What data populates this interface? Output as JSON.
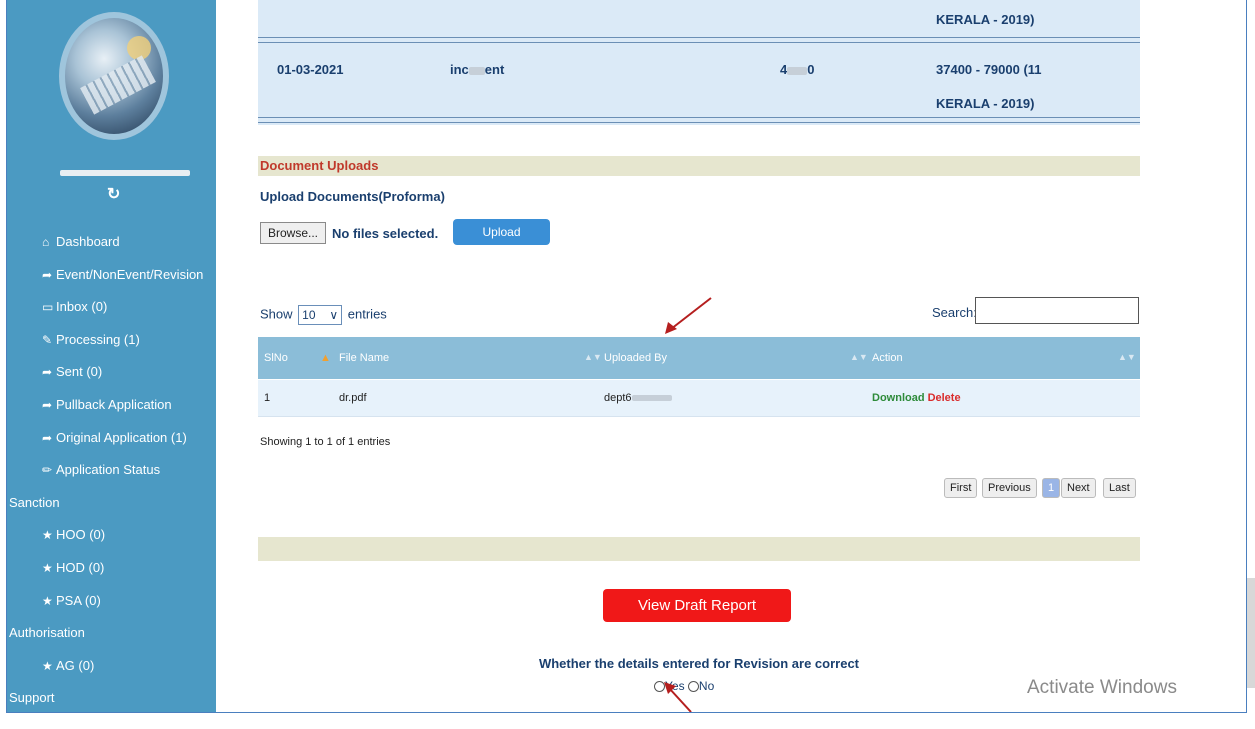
{
  "sidebar": {
    "refresh_icon": "refresh-icon",
    "items": [
      {
        "icon": "home-icon",
        "glyph": "⌂",
        "label": "Dashboard"
      },
      {
        "icon": "share-icon",
        "glyph": "➦",
        "label": "Event/NonEvent/Revision"
      },
      {
        "icon": "inbox-icon",
        "glyph": "▭",
        "label": "Inbox (0)"
      },
      {
        "icon": "edit-icon",
        "glyph": "✎",
        "label": "Processing (1)"
      },
      {
        "icon": "share-icon",
        "glyph": "➦",
        "label": "Sent (0)"
      },
      {
        "icon": "share-icon",
        "glyph": "➦",
        "label": "Pullback Application"
      },
      {
        "icon": "share-icon",
        "glyph": "➦",
        "label": "Original Application (1)"
      },
      {
        "icon": "pencil-icon",
        "glyph": "✏",
        "label": "Application Status"
      }
    ],
    "sanction_label": "Sanction",
    "sanction_items": [
      {
        "icon": "star-icon",
        "glyph": "★",
        "label": "HOO (0)"
      },
      {
        "icon": "star-icon",
        "glyph": "★",
        "label": "HOD (0)"
      },
      {
        "icon": "star-icon",
        "glyph": "★",
        "label": "PSA (0)"
      }
    ],
    "authorisation_label": "Authorisation",
    "authorisation_items": [
      {
        "icon": "star-icon",
        "glyph": "★",
        "label": "AG (0)"
      }
    ],
    "support_label": "Support"
  },
  "revision_table": {
    "row0": {
      "scale": "KERALA - 2019)"
    },
    "row1": {
      "date": "01-03-2021",
      "type_prefix": "inc",
      "type_suffix": "ent",
      "amount_prefix": "4",
      "amount_suffix": "0",
      "scale_line1": "37400 - 79000 (11",
      "scale_line2": "KERALA - 2019)"
    }
  },
  "uploads": {
    "section_title": "Document Uploads",
    "subtitle": "Upload Documents(Proforma)",
    "browse_label": "Browse...",
    "no_file_text": "No files selected.",
    "upload_label": "Upload"
  },
  "datatable": {
    "show_label": "Show",
    "page_length": "10",
    "entries_label": "entries",
    "search_label": "Search:",
    "search_value": "",
    "columns": [
      "SlNo",
      "File Name",
      "Uploaded By",
      "Action"
    ],
    "rows": [
      {
        "slno": "1",
        "file": "dr.pdf",
        "by_prefix": "dept6",
        "download": "Download",
        "delete": "Delete"
      }
    ],
    "info": "Showing 1 to 1 of 1 entries",
    "pager": {
      "first": "First",
      "previous": "Previous",
      "current": "1",
      "next": "Next",
      "last": "Last"
    }
  },
  "draft_button": "View Draft Report",
  "confirm": {
    "question": "Whether the details entered for Revision are correct",
    "yes": "Yes",
    "no": "No"
  },
  "watermark": "Activate Windows",
  "colors": {
    "sidebar": "#4b9ac2",
    "header_row": "#8bbdd8",
    "draft_button": "#f01818",
    "upload_button": "#3a8fd6",
    "delete": "#c0392b",
    "download": "#2e8b3a"
  }
}
